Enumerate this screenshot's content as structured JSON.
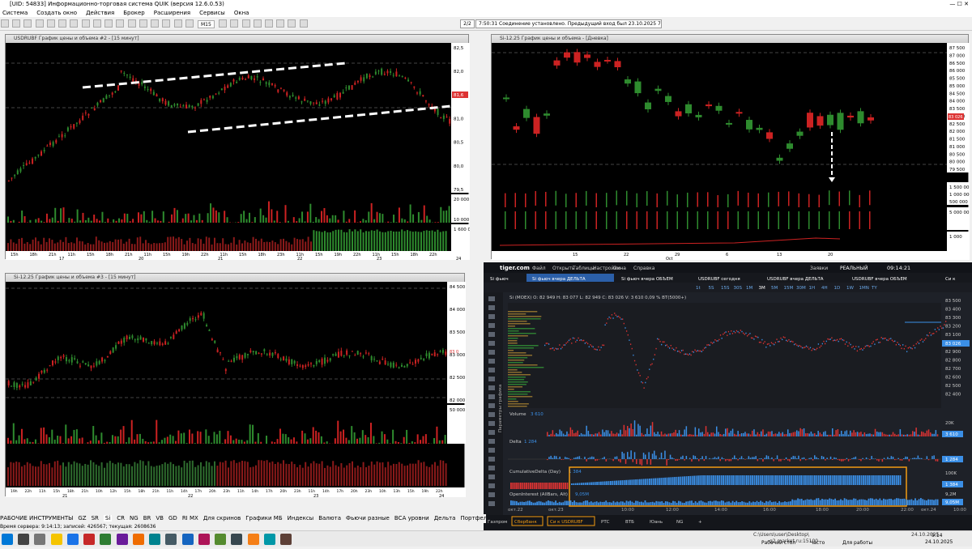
{
  "window": {
    "title": "[UID: 54833] Информационно-торговая система QUIK (версия 12.6.0.53)",
    "menu": [
      "Система",
      "Создать окно",
      "Действия",
      "Брокер",
      "Расширения",
      "Сервисы",
      "Окна"
    ],
    "connection_status": "7:50:31  Соединение установлено. Предыдущий вход был 23.10.2025 7:22:55 с",
    "interval_label": "M15",
    "page_counter": "2/2"
  },
  "panels": {
    "top_left": {
      "title": "USDRUBF График цены и объема #2 - [15 минут]",
      "price_ticks": [
        "82,5",
        "82,0",
        "81,5",
        "81,0",
        "80,5",
        "80,0",
        "79,5"
      ],
      "volume_ticks": [
        "20 000",
        "10 000"
      ],
      "oi_ticks": [
        "1 600 00"
      ],
      "x_times": [
        "15h",
        "18h",
        "21h",
        "11h",
        "15h",
        "18h",
        "21h",
        "11h",
        "15h",
        "19h",
        "22h",
        "11h",
        "15h",
        "18h",
        "23h",
        "11h",
        "15h",
        "19h",
        "22h",
        "11h",
        "15h",
        "18h",
        "22h"
      ],
      "x_days": [
        "17",
        "20",
        "21",
        "22",
        "23",
        "24"
      ],
      "last_price": "81,6"
    },
    "top_right": {
      "title": "Si-12.25 График цены и объема - [Дневка]",
      "price_ticks": [
        "87 500",
        "87 000",
        "86 500",
        "86 000",
        "85 500",
        "85 000",
        "84 500",
        "84 000",
        "83 500",
        "83 000",
        "82 500",
        "82 000",
        "81 500",
        "81 000",
        "80 500",
        "80 000",
        "79 500"
      ],
      "volume_ticks": [
        "1 500 00",
        "1 000 000",
        "500 000"
      ],
      "vol2_ticks": [
        "5 000 00"
      ],
      "oi_ticks": [
        "1 000"
      ],
      "x_days": [
        "15",
        "22",
        "29",
        "6",
        "13",
        "20"
      ],
      "x_month": "Oct",
      "last_price": "83 026"
    },
    "bottom_left": {
      "title": "Si-12.25 График цены и объема #3 - [15 минут]",
      "price_ticks": [
        "84 500",
        "84 000",
        "83 500",
        "83 000",
        "82 500",
        "82 000"
      ],
      "volume_ticks": [
        "50 000"
      ],
      "x_times": [
        "19h",
        "22h",
        "11h",
        "15h",
        "18h",
        "21h",
        "10h",
        "12h",
        "15h",
        "18h",
        "21h",
        "11h",
        "14h",
        "17h",
        "20h",
        "23h",
        "11h",
        "14h",
        "17h",
        "20h",
        "23h",
        "11h",
        "14h",
        "17h",
        "20h",
        "23h",
        "10h",
        "13h",
        "15h",
        "19h",
        "22h"
      ],
      "x_days": [
        "21",
        "22",
        "23",
        "24"
      ],
      "last_price": "83 0"
    }
  },
  "tiger": {
    "brand": "tiger.com",
    "menu": [
      "Файл",
      "Открыть",
      "Таблицы",
      "Настройки",
      "Окна",
      "Справка"
    ],
    "account_label": "Заявки",
    "mode": "РЕАЛЬНЫЙ",
    "clock": "09:14:21",
    "tabs": [
      "Si фьюч",
      "Si фьюч вчера ДЕЛЬТА",
      "Si фьюч вчера ОБЪЕМ",
      "USDRUBF сегодня",
      "USDRUBF вчера ДЕЛЬТА",
      "USDRUBF вчера ОБЪЕМ",
      "Си к"
    ],
    "timeframes": [
      "1t",
      "5S",
      "15S",
      "30S",
      "1M",
      "3M",
      "5M",
      "15M",
      "30M",
      "1H",
      "4H",
      "1D",
      "1W",
      "1MN",
      "TY"
    ],
    "ohlc": "Si (MOEX)  O: 82 949  H: 83 077  L: 82 949  C: 83 026  V: 3 610  0,09 %    BT(5000+)",
    "price_ticks": [
      "83 500",
      "83 400",
      "83 300",
      "83 200",
      "83 100",
      "83 000",
      "82 900",
      "82 800",
      "82 700",
      "82 600",
      "82 500",
      "82 400"
    ],
    "last_price": "83 026",
    "sidebar_label": "Параметры графика",
    "volume_label": "Volume",
    "volume_value": "3 610",
    "volume_tick": "20K",
    "delta_label": "Delta",
    "delta_value": "1 284",
    "delta_tag": "1 284",
    "cumdelta_label": "CumulativeDelta (Day)",
    "cumdelta_value": "1 384",
    "cumdelta_tick": "100K",
    "cumdelta_tag": "1 384",
    "oi_label": "OpenInterest (AllBars, Alt)",
    "oi_value": "9,05M",
    "oi_ticks": [
      "9,2M",
      "9,05M"
    ],
    "x_times": [
      "окт.22",
      "окт.23",
      "10:00",
      "12:00",
      "14:00",
      "16:00",
      "18:00",
      "20:00",
      "22:00",
      "окт.24",
      "10:00"
    ],
    "bottom_tabs": [
      "Газпром",
      "Сбербанк",
      "Си к USDRUBF",
      "РТС",
      "ВТБ",
      "Юань",
      "NG",
      "+"
    ]
  },
  "bottom_tabs": [
    "РАБОЧИЕ ИНСТРУМЕНТЫ",
    "GZ",
    "SR",
    "Si",
    "CR",
    "NG",
    "BR",
    "VB",
    "GD",
    "RI MX",
    "Для скринов",
    "Графики МБ",
    "Индексы",
    "Валюта",
    "Фьючи разные",
    "ВСА уровни",
    "Дельта",
    "Портфель ФОРТС",
    "Портфе"
  ],
  "status_line": "Время сервера: 9:14:13; записей: 426567; текущая: 2608636",
  "taskbar": {
    "tray_path": "C:\\Users\\user\\Desktop\\",
    "tray_file": "q2.market.ru:15100",
    "desktop1": "Рабочий стол",
    "desktop2": "Часто",
    "desktop3": "Для работы",
    "time": "9:14",
    "date": "24.10.2025",
    "date2": "24.10.2025"
  },
  "colors": {
    "up": "#2e8b2e",
    "down": "#cc2222",
    "tiger_up": "#3b8fe6",
    "tiger_down": "#d33",
    "accent_orange": "#f39c12"
  }
}
